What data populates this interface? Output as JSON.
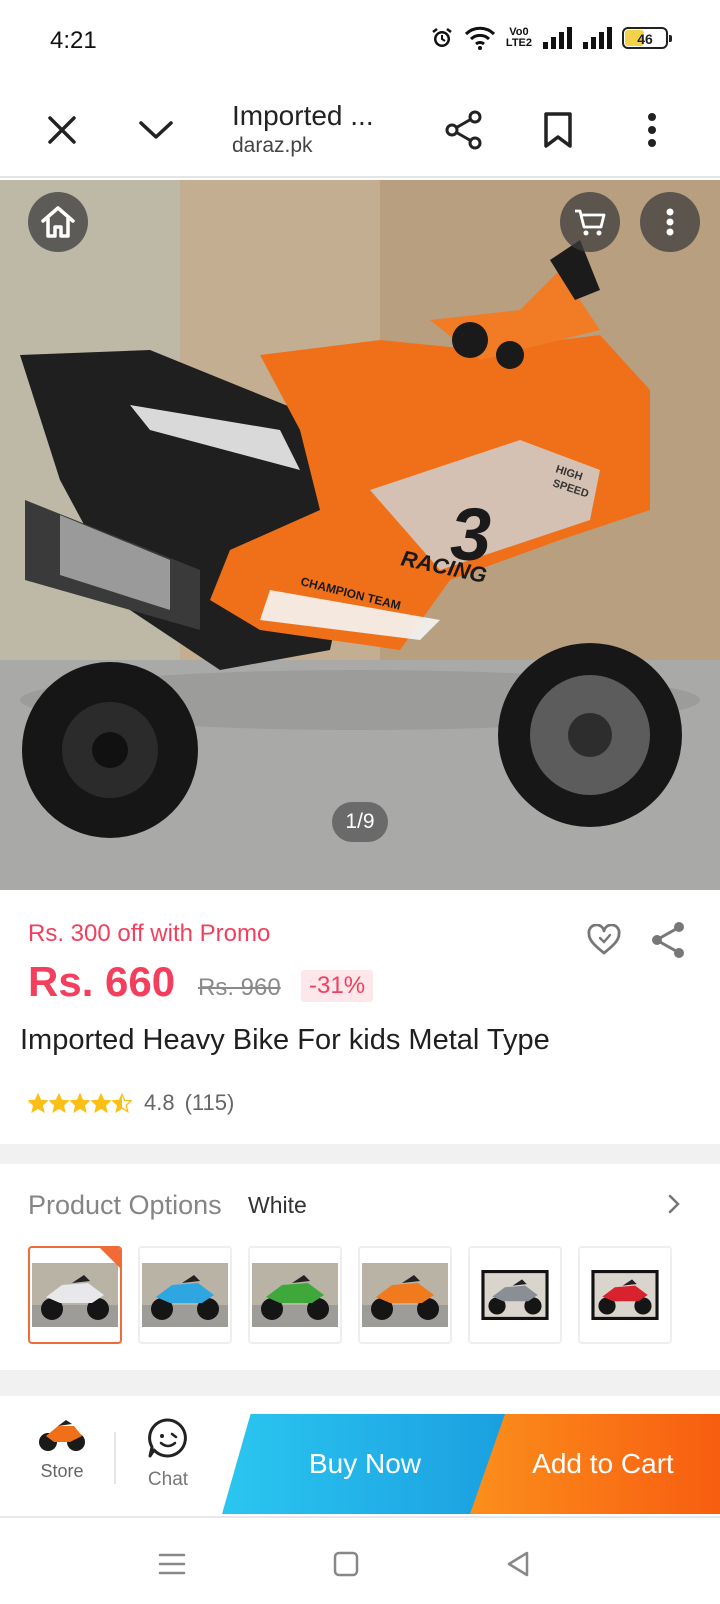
{
  "status_bar": {
    "time": "4:21",
    "volte_top": "Vo0",
    "volte_bottom": "LTE2",
    "battery": "46",
    "battery_level": 0.46,
    "icons": [
      "alarm-icon",
      "wifi-icon",
      "volte-icon",
      "signal-icon",
      "signal-icon",
      "battery-icon"
    ]
  },
  "browser": {
    "title": "Imported ...",
    "url": "daraz.pk",
    "icons": [
      "close-icon",
      "chevron-down-icon",
      "share-icon",
      "bookmark-icon",
      "more-vertical-icon"
    ]
  },
  "gallery": {
    "counter": "1/9",
    "icons": [
      "home-icon",
      "cart-icon",
      "more-vertical-icon"
    ],
    "decal_number": "3",
    "decal_racing": "RACING",
    "decal_team": "CHAMPION TEAM",
    "decal_speed_1": "HIGH",
    "decal_speed_2": "SPEED"
  },
  "product": {
    "promo": "Rs. 300 off with Promo",
    "price": "Rs. 660",
    "old_price": "Rs. 960",
    "discount": "-31%",
    "title": "Imported Heavy Bike For kids Metal Type",
    "rating_value": "4.8",
    "rating_count": "(115)",
    "stars": 4.5
  },
  "options": {
    "label": "Product Options",
    "selected": "White",
    "variants": [
      {
        "color": "#e8e8ea",
        "selected": true
      },
      {
        "color": "#2ea6e0",
        "selected": false
      },
      {
        "color": "#3fa83a",
        "selected": false
      },
      {
        "color": "#f07a1e",
        "selected": false
      },
      {
        "color": "#8a8f96",
        "selected": false
      },
      {
        "color": "#d8222e",
        "selected": false
      }
    ]
  },
  "actions": {
    "store": "Store",
    "chat": "Chat",
    "buy_now": "Buy Now",
    "add_to_cart": "Add to Cart"
  },
  "colors": {
    "price_red": "#f33f5d",
    "buy_now_blue": "#1a9fe0",
    "add_cart_orange": "#f85d10",
    "selected_border": "#f26b36",
    "star_yellow": "#fbbf16"
  }
}
